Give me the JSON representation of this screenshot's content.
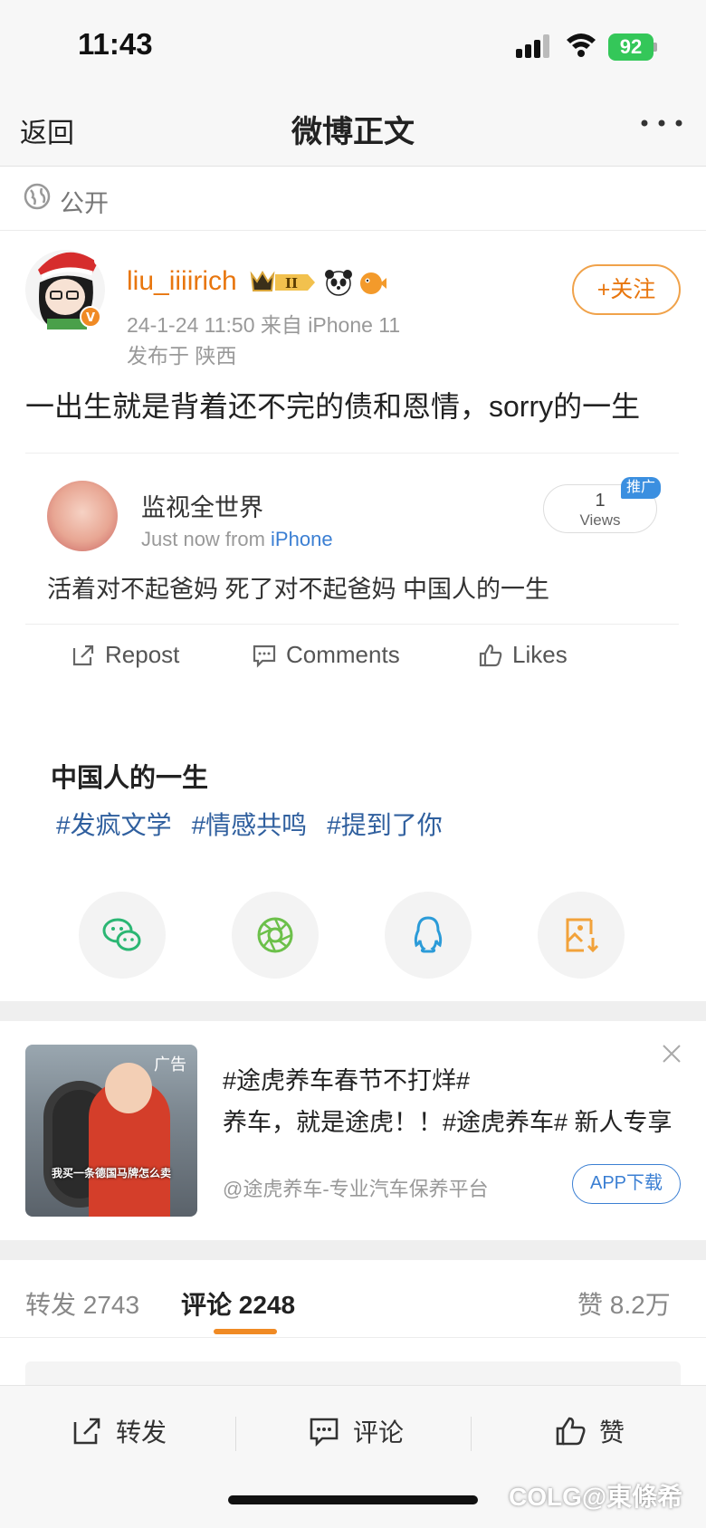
{
  "status_bar": {
    "time": "11:43",
    "battery": "92"
  },
  "nav": {
    "back": "返回",
    "title": "微博正文"
  },
  "visibility": {
    "label": "公开"
  },
  "post": {
    "username": "liu_iiiirich",
    "time_source": "24-1-24 11:50  来自 iPhone 11",
    "location": "发布于 陕西",
    "follow": "+关注",
    "text": "一出生就是背着还不完的债和恩情，sorry的一生"
  },
  "card": {
    "name": "监视全世界",
    "time": "Just now  from ",
    "source": "iPhone",
    "views_count": "1",
    "views_label": "Views",
    "promo": "推广",
    "text": "活着对不起爸妈 死了对不起爸妈 中国人的一生",
    "actions": {
      "repost": "Repost",
      "comments": "Comments",
      "likes": "Likes"
    }
  },
  "topic": {
    "title": "中国人的一生",
    "tags": [
      "#发疯文学",
      "#情感共鸣",
      "#提到了你"
    ]
  },
  "ad": {
    "badge": "广告",
    "caption": "我买一条德国马牌怎么卖",
    "line1": "#途虎养车春节不打烊#",
    "line2": "养车，就是途虎！！#途虎养车# 新人专享",
    "source": "@途虎养车-专业汽车保养平台",
    "download": "APP下载"
  },
  "tabs": {
    "repost": "转发 2743",
    "comment": "评论 2248",
    "like": "赞 8.2万"
  },
  "toolbar": {
    "repost": "转发",
    "comment": "评论",
    "like": "赞"
  },
  "watermark": "COLG@東條希",
  "colors": {
    "accent": "#f08a24",
    "link": "#2f5f9e",
    "username": "#e8760e"
  }
}
